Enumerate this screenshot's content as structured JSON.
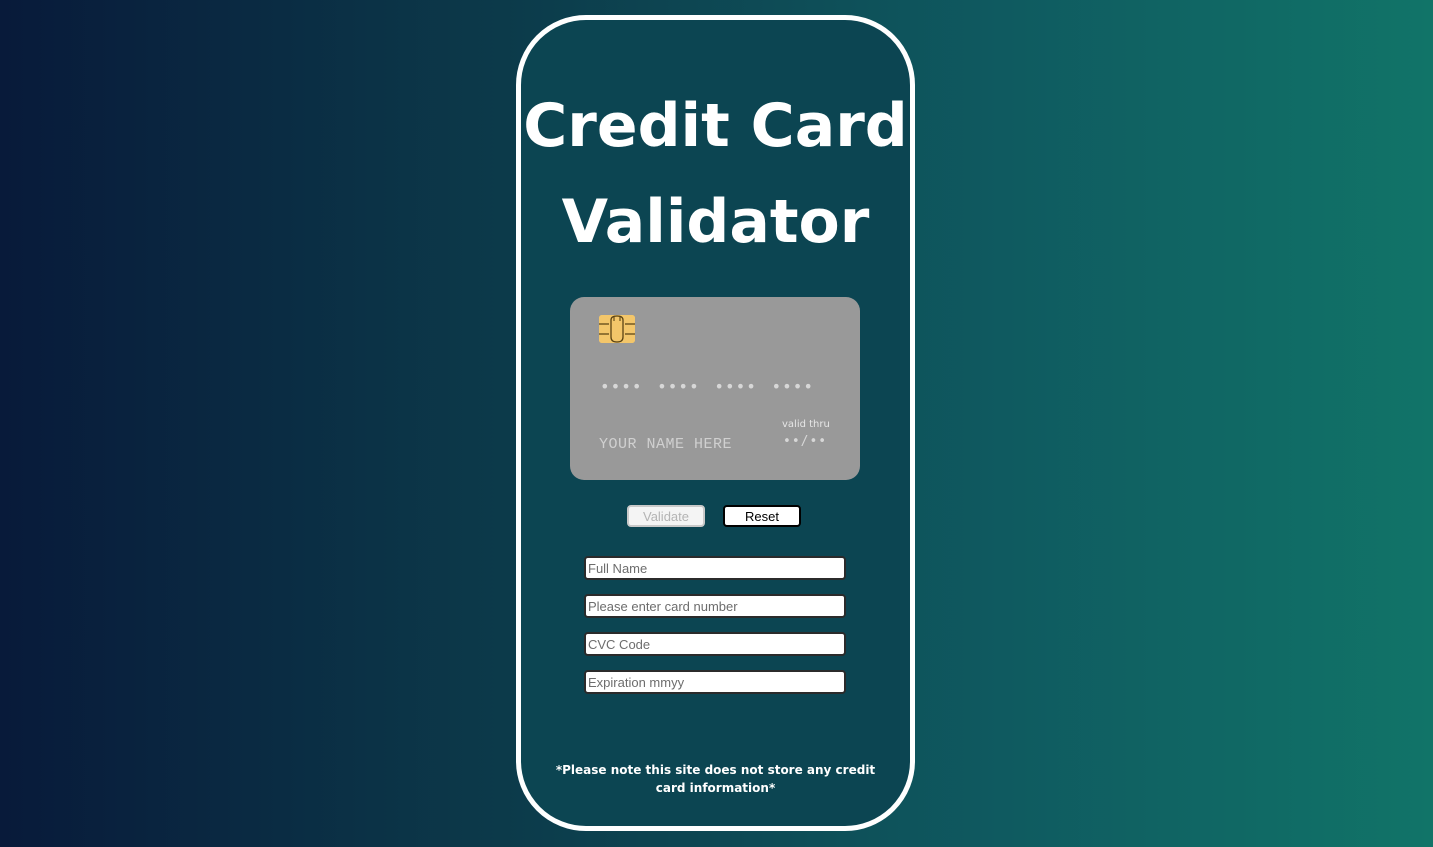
{
  "title": {
    "line1": "Credit Card",
    "line2": "Validator"
  },
  "card": {
    "number_mask": "•••• •••• •••• ••••",
    "name_placeholder": "YOUR NAME HERE",
    "valid_thru_label": "valid thru",
    "expiry_mask": "••/••",
    "chip_icon": "card-chip-icon"
  },
  "buttons": {
    "validate_label": "Validate",
    "reset_label": "Reset"
  },
  "form": {
    "full_name": {
      "placeholder": "Full Name",
      "value": ""
    },
    "card_number": {
      "placeholder": "Please enter card number",
      "value": ""
    },
    "cvc": {
      "placeholder": "CVC Code",
      "value": ""
    },
    "expiration": {
      "placeholder": "Expiration mmyy",
      "value": ""
    }
  },
  "disclaimer": "*Please note this site does not store any credit card information*",
  "colors": {
    "panel_border": "#ffffff",
    "card_background": "#999999",
    "chip": "#f3c66a"
  }
}
